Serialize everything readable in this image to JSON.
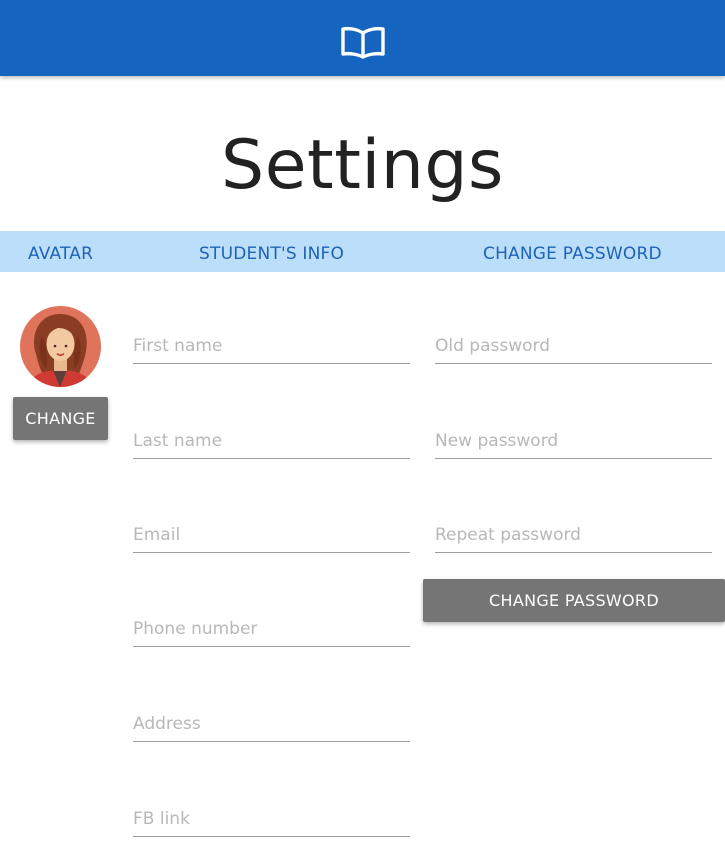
{
  "header": {
    "logo_icon": "open-book-icon",
    "background": "#1565c0"
  },
  "page": {
    "title": "Settings"
  },
  "tabs": [
    {
      "label": "AVATAR"
    },
    {
      "label": "STUDENT'S INFO"
    },
    {
      "label": "CHANGE PASSWORD"
    }
  ],
  "avatar": {
    "icon": "woman-avatar-icon",
    "change_label": "CHANGE"
  },
  "student_info": {
    "first_name": {
      "placeholder": "First name",
      "value": ""
    },
    "last_name": {
      "placeholder": "Last name",
      "value": ""
    },
    "email": {
      "placeholder": "Email",
      "value": ""
    },
    "phone": {
      "placeholder": "Phone number",
      "value": ""
    },
    "address": {
      "placeholder": "Address",
      "value": ""
    },
    "fb_link": {
      "placeholder": "FB link",
      "value": ""
    }
  },
  "password": {
    "old": {
      "placeholder": "Old password",
      "value": ""
    },
    "new": {
      "placeholder": "New password",
      "value": ""
    },
    "repeat": {
      "placeholder": "Repeat password",
      "value": ""
    },
    "submit_label": "CHANGE PASSWORD"
  },
  "colors": {
    "primary": "#1565c0",
    "tab_bar": "#bbdefb",
    "tab_text": "#1e63b5",
    "button": "#757575"
  }
}
